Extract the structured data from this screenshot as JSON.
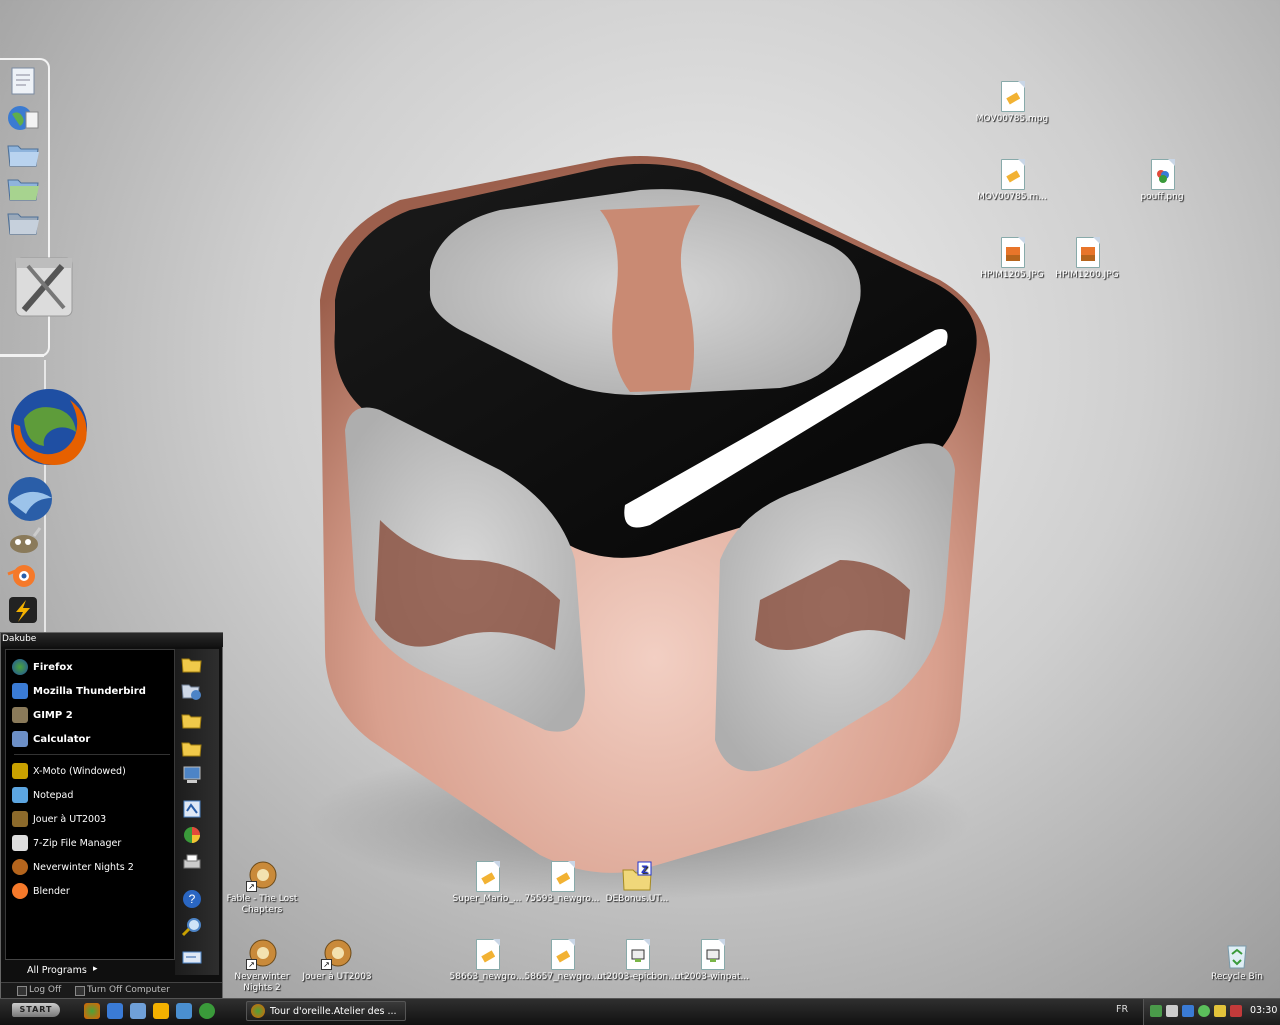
{
  "desktop": {
    "icons": [
      {
        "label": "MOV00785.mpg",
        "kind": "video"
      },
      {
        "label": "MOV00785.m...",
        "kind": "video"
      },
      {
        "label": "pouff.png",
        "kind": "image"
      },
      {
        "label": "HPIM1205.JPG",
        "kind": "photo"
      },
      {
        "label": "HPIM1200.JPG",
        "kind": "photo"
      },
      {
        "label": "Fable - The Lost Chapters",
        "kind": "game-shortcut"
      },
      {
        "label": "Super_Mario_...",
        "kind": "video"
      },
      {
        "label": "75593_newgro...",
        "kind": "video"
      },
      {
        "label": "DEBonus.UT...",
        "kind": "zip-folder"
      },
      {
        "label": "Neverwinter Nights 2",
        "kind": "game-shortcut"
      },
      {
        "label": "Jouer à UT2003",
        "kind": "game-shortcut"
      },
      {
        "label": "58663_newgro...",
        "kind": "video"
      },
      {
        "label": "58657_newgro...",
        "kind": "video"
      },
      {
        "label": "ut2003-epicbon...",
        "kind": "installer"
      },
      {
        "label": "ut2003-winpat...",
        "kind": "installer"
      },
      {
        "label": "Recycle Bin",
        "kind": "recycle-bin"
      }
    ]
  },
  "dock": {
    "items": [
      "document-icon",
      "globe-icon",
      "folder-icon",
      "folder-green-icon",
      "folder-gray-icon",
      "tools-icon",
      "firefox-icon",
      "thunderbird-icon",
      "gimp-icon",
      "blender-icon",
      "winamp-icon"
    ]
  },
  "start_menu": {
    "user": "Dakube",
    "pinned": [
      {
        "label": "Firefox",
        "color": "#e66000"
      },
      {
        "label": "Mozilla Thunderbird",
        "color": "#3a7bd5"
      },
      {
        "label": "GIMP 2",
        "color": "#8a7a5a"
      },
      {
        "label": "Calculator",
        "color": "#6c8fc7"
      }
    ],
    "recent": [
      {
        "label": "X-Moto (Windowed)",
        "color": "#c9a100"
      },
      {
        "label": "Notepad",
        "color": "#5ca5e0"
      },
      {
        "label": "Jouer à UT2003",
        "color": "#8c6a2b"
      },
      {
        "label": "7-Zip File Manager",
        "color": "#dddddd"
      },
      {
        "label": "Neverwinter Nights 2",
        "color": "#b5651d"
      },
      {
        "label": "Blender",
        "color": "#f5792a"
      }
    ],
    "all_programs": "All Programs",
    "log_off": "Log Off",
    "turn_off": "Turn Off Computer"
  },
  "taskbar": {
    "start_label": "START",
    "active_task": "Tour d'oreille.Atelier des ...",
    "language": "FR",
    "clock": "03:30"
  },
  "colors": {
    "accent": "#e66000",
    "cube_copper": "#d9a08e"
  }
}
